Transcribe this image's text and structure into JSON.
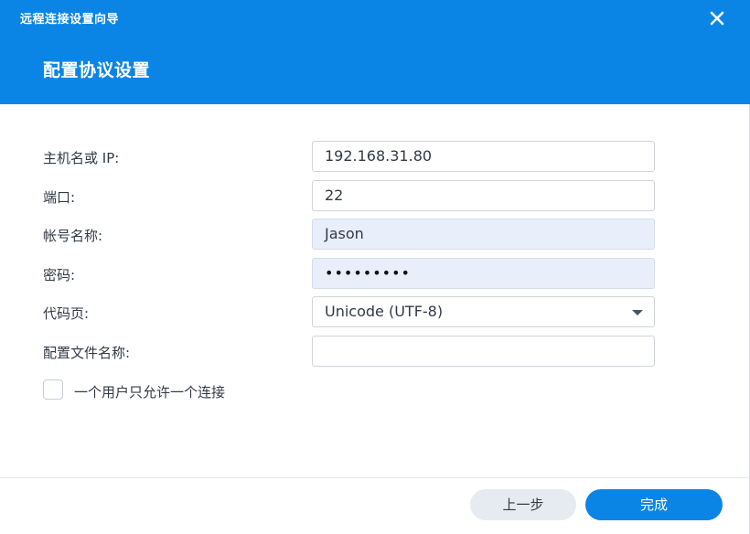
{
  "window": {
    "title": "远程连接设置向导",
    "close_icon": "close-icon"
  },
  "header": {
    "step_title": "配置协议设置",
    "accent_color": "#0a85e6"
  },
  "form": {
    "host": {
      "label": "主机名或 IP:",
      "value": "192.168.31.80"
    },
    "port": {
      "label": "端口:",
      "value": "22"
    },
    "account": {
      "label": "帐号名称:",
      "value": "Jason"
    },
    "password": {
      "label": "密码:",
      "value": "•••••••••"
    },
    "codepage": {
      "label": "代码页:",
      "selected": "Unicode (UTF-8)"
    },
    "profile_name": {
      "label": "配置文件名称:",
      "value": ""
    }
  },
  "options": {
    "single_connection": {
      "label": "一个用户只允许一个连接",
      "checked": false
    }
  },
  "footer": {
    "prev_label": "上一步",
    "finish_label": "完成"
  }
}
